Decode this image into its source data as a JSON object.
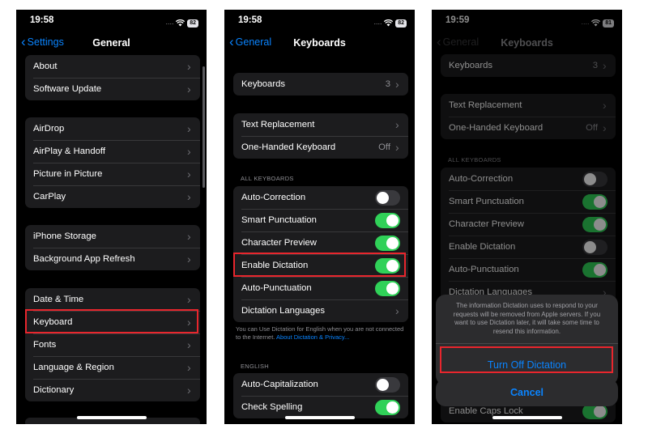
{
  "phone1": {
    "status": {
      "time": "19:58",
      "battery": "82"
    },
    "nav": {
      "back": "Settings",
      "title": "General"
    },
    "group1": [
      {
        "label": "About"
      },
      {
        "label": "Software Update"
      }
    ],
    "group2": [
      {
        "label": "AirDrop"
      },
      {
        "label": "AirPlay & Handoff"
      },
      {
        "label": "Picture in Picture"
      },
      {
        "label": "CarPlay"
      }
    ],
    "group3": [
      {
        "label": "iPhone Storage"
      },
      {
        "label": "Background App Refresh"
      }
    ],
    "group4": [
      {
        "label": "Date & Time"
      },
      {
        "label": "Keyboard"
      },
      {
        "label": "Fonts"
      },
      {
        "label": "Language & Region"
      },
      {
        "label": "Dictionary"
      }
    ]
  },
  "phone2": {
    "status": {
      "time": "19:58",
      "battery": "82"
    },
    "nav": {
      "back": "General",
      "title": "Keyboards"
    },
    "keyboards": {
      "label": "Keyboards",
      "value": "3"
    },
    "group2": [
      {
        "label": "Text Replacement",
        "value": ""
      },
      {
        "label": "One-Handed Keyboard",
        "value": "Off"
      }
    ],
    "section_all": "ALL KEYBOARDS",
    "all_keyboards": [
      {
        "label": "Auto-Correction",
        "on": false
      },
      {
        "label": "Smart Punctuation",
        "on": true
      },
      {
        "label": "Character Preview",
        "on": true
      },
      {
        "label": "Enable Dictation",
        "on": true
      },
      {
        "label": "Auto-Punctuation",
        "on": true
      },
      {
        "label": "Dictation Languages"
      }
    ],
    "footnote": "You can Use Dictation for English when you are not connected to the Internet.",
    "footnote_link": "About Dictation & Privacy...",
    "section_english": "ENGLISH",
    "english": [
      {
        "label": "Auto-Capitalization",
        "on": false
      },
      {
        "label": "Check Spelling",
        "on": true
      }
    ]
  },
  "phone3": {
    "status": {
      "time": "19:59",
      "battery": "81"
    },
    "nav": {
      "back": "General",
      "title": "Keyboards"
    },
    "keyboards": {
      "label": "Keyboards",
      "value": "3"
    },
    "group2": [
      {
        "label": "Text Replacement",
        "value": ""
      },
      {
        "label": "One-Handed Keyboard",
        "value": "Off"
      }
    ],
    "section_all": "ALL KEYBOARDS",
    "all_keyboards": [
      {
        "label": "Auto-Correction",
        "on": false
      },
      {
        "label": "Smart Punctuation",
        "on": true
      },
      {
        "label": "Character Preview",
        "on": true
      },
      {
        "label": "Enable Dictation",
        "on": false
      },
      {
        "label": "Auto-Punctuation",
        "on": true
      },
      {
        "label": "Dictation Languages"
      }
    ],
    "partial_row": {
      "label": "Enable Caps Lock",
      "on": true
    },
    "alert": {
      "message": "The information Dictation uses to respond to your requests will be removed from Apple servers. If you want to use Dictation later, it will take some time to resend this information.",
      "action": "Turn Off Dictation",
      "cancel": "Cancel"
    }
  },
  "icons": {
    "chevron_right": "›",
    "chevron_left": "‹",
    "wifi": "⌔",
    "signal": "····"
  },
  "colors": {
    "accent": "#0a84ff",
    "toggle_on": "#30d158",
    "highlight": "#e8262d"
  }
}
